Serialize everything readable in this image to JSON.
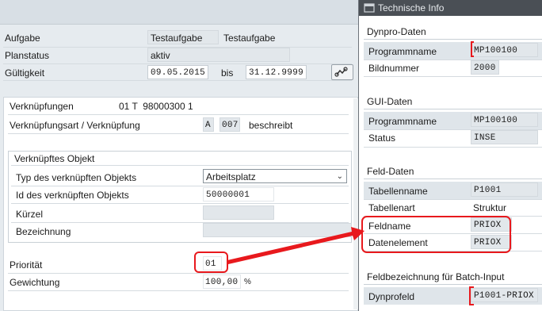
{
  "main": {
    "aufgabe_label": "Aufgabe",
    "aufgabe_code": "Testaufgabe",
    "aufgabe_text": "Testaufgabe",
    "planstatus_label": "Planstatus",
    "planstatus_value": "aktiv",
    "gueltigkeit_label": "Gültigkeit",
    "gueltigkeit_from": "09.05.2015",
    "bis_label": "bis",
    "gueltigkeit_to": "31.12.9999",
    "verknuepfungen_label": "Verknüpfungen",
    "verknuepfungen_value": "01 T  98000300 1",
    "verknuepfungsart_label": "Verknüpfungsart / Verknüpfung",
    "verknuepfungsart_a": "A",
    "verknuepfungsart_code": "007",
    "verknuepfungsart_text": "beschreibt",
    "objekt_group_title": "Verknüpftes Objekt",
    "typ_label": "Typ des verknüpften Objekts",
    "typ_value": "Arbeitsplatz",
    "id_label": "Id des verknüpften Objekts",
    "id_value": "50000001",
    "kuerzel_label": "Kürzel",
    "kuerzel_value": "",
    "bezeichnung_label": "Bezeichnung",
    "bezeichnung_value": "",
    "prioritaet_label": "Priorität",
    "prioritaet_value": "01",
    "gewichtung_label": "Gewichtung",
    "gewichtung_value": "100,00",
    "gewichtung_unit": "%"
  },
  "tech": {
    "title": "Technische Info",
    "dynpro_title": "Dynpro-Daten",
    "dynpro_programmname_label": "Programmname",
    "dynpro_programmname_value": "MP100100",
    "bildnummer_label": "Bildnummer",
    "bildnummer_value": "2000",
    "gui_title": "GUI-Daten",
    "gui_programmname_label": "Programmname",
    "gui_programmname_value": "MP100100",
    "status_label": "Status",
    "status_value": "INSE",
    "feld_title": "Feld-Daten",
    "tabellenname_label": "Tabellenname",
    "tabellenname_value": "P1001",
    "tabellenart_label": "Tabellenart",
    "tabellenart_value": "Struktur",
    "feldname_label": "Feldname",
    "feldname_value": "PRIOX",
    "datenelement_label": "Datenelement",
    "datenelement_value": "PRIOX",
    "batch_title": "Feldbezeichnung für Batch-Input",
    "dynprofeld_label": "Dynprofeld",
    "dynprofeld_value": "P1001-PRIOX"
  },
  "colors": {
    "highlight_red": "#e8191d",
    "tech_titlebar": "#4a4f55",
    "panel_bg": "#ffffff"
  }
}
